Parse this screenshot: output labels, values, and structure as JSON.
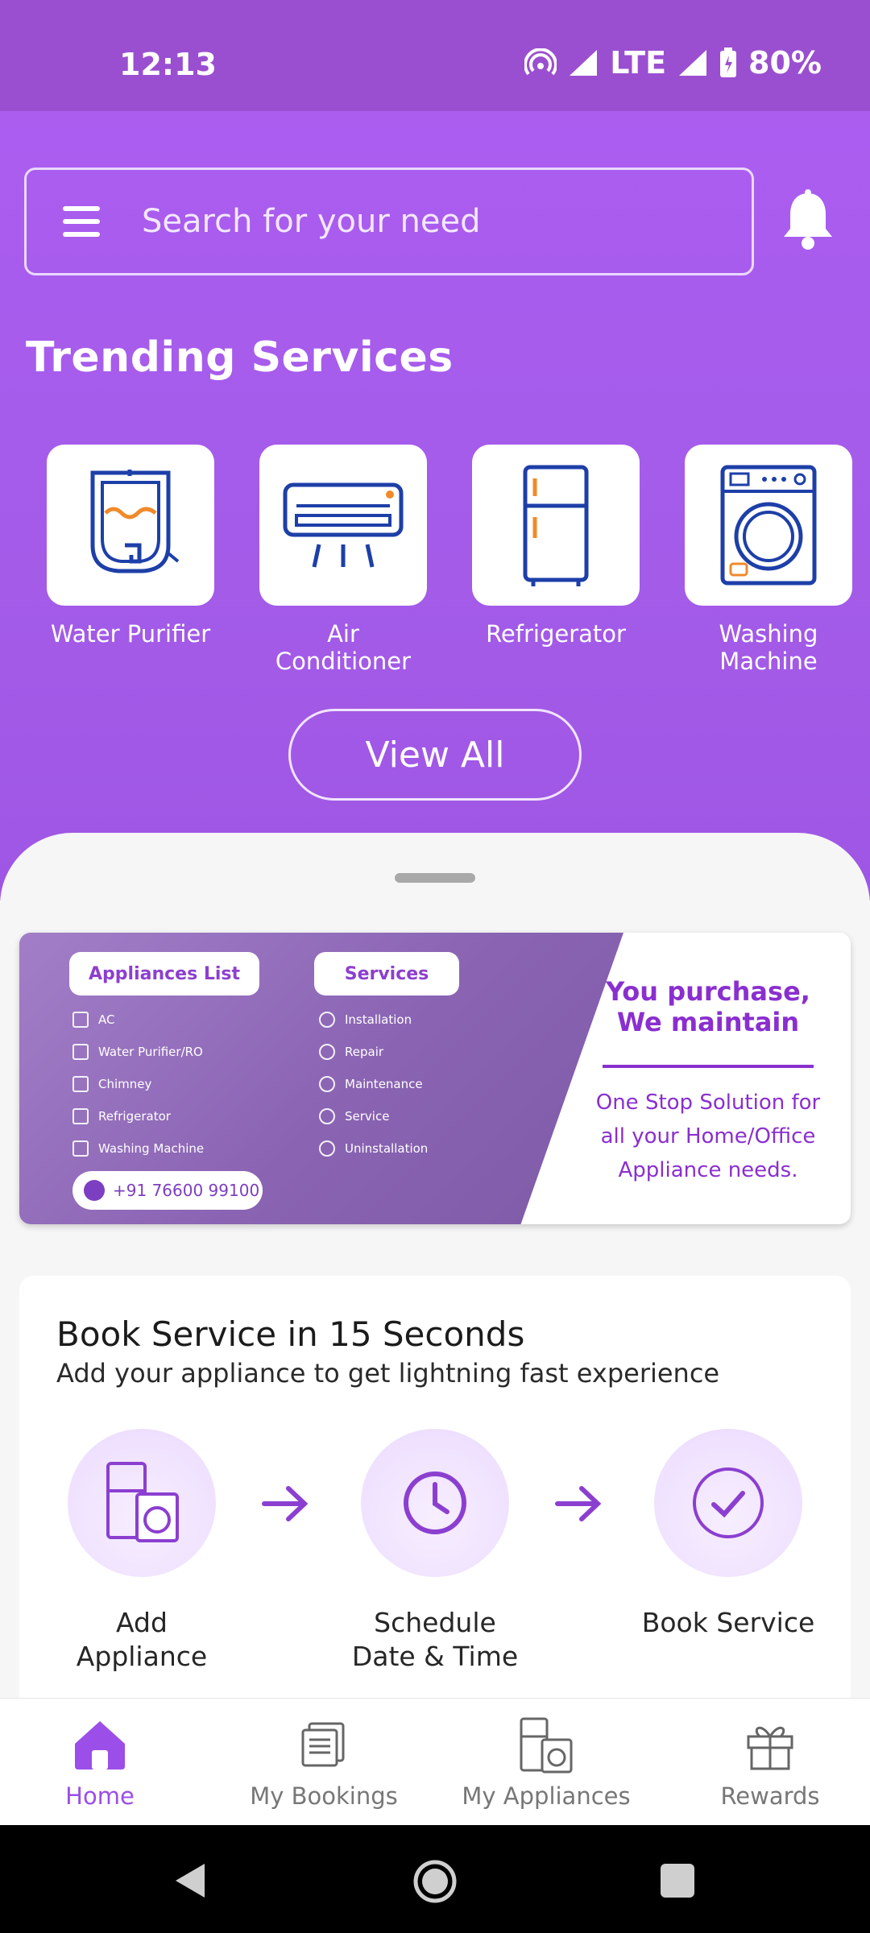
{
  "status_bar": {
    "time": "12:13",
    "network": "LTE",
    "battery": "80%"
  },
  "search": {
    "placeholder": "Search for your need"
  },
  "trending": {
    "title": "Trending Services",
    "items": [
      {
        "label": "Water Purifier",
        "icon": "water-purifier-icon"
      },
      {
        "label": "Air Conditioner",
        "icon": "air-conditioner-icon"
      },
      {
        "label": "Refrigerator",
        "icon": "refrigerator-icon"
      },
      {
        "label": "Washing Machine",
        "icon": "washing-machine-icon"
      }
    ],
    "view_all": "View All"
  },
  "banner": {
    "appliances_title": "Appliances List",
    "appliances": [
      "AC",
      "Water Purifier/RO",
      "Chimney",
      "Refrigerator",
      "Washing Machine"
    ],
    "services_title": "Services",
    "services": [
      "Installation",
      "Repair",
      "Maintenance",
      "Service",
      "Uninstallation"
    ],
    "phone": "+91 76600 99100",
    "headline_1": "You purchase,",
    "headline_2": "We maintain",
    "tagline_1": "One Stop Solution for",
    "tagline_2": "all your Home/Office",
    "tagline_3": "Appliance needs."
  },
  "book": {
    "title": "Book Service in 15 Seconds",
    "subtitle": "Add your appliance to get lightning fast experience",
    "steps": [
      {
        "label_1": "Add",
        "label_2": "Appliance"
      },
      {
        "label_1": "Schedule",
        "label_2": "Date & Time"
      },
      {
        "label_1": "Book Service",
        "label_2": ""
      }
    ]
  },
  "bottom_nav": [
    {
      "label": "Home",
      "icon": "home-icon",
      "active": true
    },
    {
      "label": "My Bookings",
      "icon": "bookings-icon"
    },
    {
      "label": "My Appliances",
      "icon": "appliances-icon"
    },
    {
      "label": "Rewards",
      "icon": "gift-icon"
    }
  ],
  "colors": {
    "accent": "#9b4ee8",
    "header": "#ab5df0",
    "text_purple": "#8a2fcf"
  }
}
